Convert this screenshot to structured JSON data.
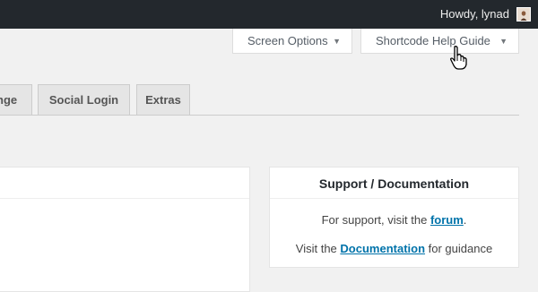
{
  "admin_bar": {
    "greeting": "Howdy, lynad",
    "avatar_icon": "user-avatar"
  },
  "screen_meta": {
    "screen_options_label": "Screen Options",
    "shortcode_help_label": "Shortcode Help Guide",
    "dropdown_icon": "triangle-down"
  },
  "tabs": [
    {
      "label": "nge"
    },
    {
      "label": "Social Login"
    },
    {
      "label": "Extras"
    }
  ],
  "support": {
    "title": "Support / Documentation",
    "line1_pre": "For support, visit the ",
    "line1_link": "forum",
    "line1_post": ".",
    "line2_pre": "Visit the ",
    "line2_link": "Documentation",
    "line2_post": " for guidance"
  },
  "colors": {
    "admin_bar_bg": "#23282d",
    "page_bg": "#f1f1f1",
    "link": "#0073aa"
  }
}
